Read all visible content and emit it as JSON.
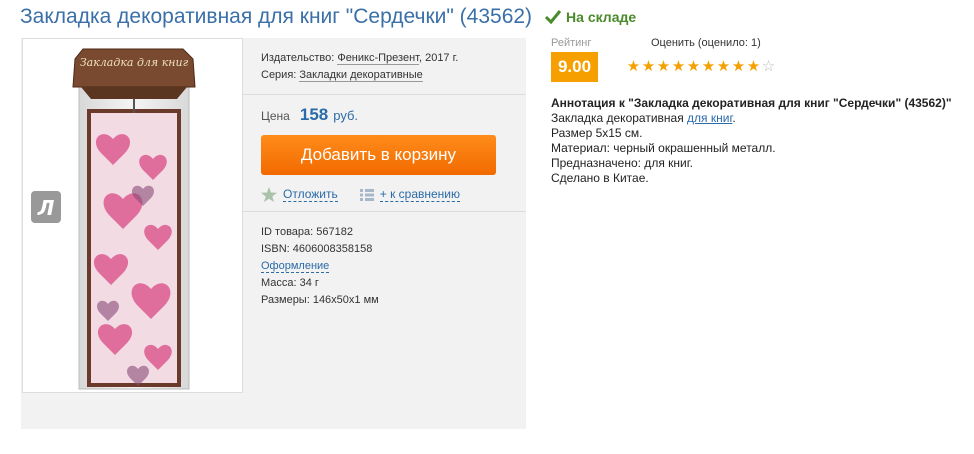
{
  "header": {
    "title": "Закладка декоративная для книг \"Сердечки\" (43562)",
    "stock": "На складе"
  },
  "details": {
    "publisher_label": "Издательство:",
    "publisher_link": "Феникс-Презент",
    "publisher_year": ", 2017 г.",
    "series_label": "Серия:",
    "series_link": "Закладки декоративные"
  },
  "price": {
    "label": "Цена",
    "value": "158",
    "currency": "руб."
  },
  "cart_button": "Добавить в корзину",
  "actions": {
    "defer": "Отложить",
    "compare": "+ к сравнению"
  },
  "meta": {
    "id_line": "ID товара: 567182",
    "isbn_line": "ISBN: 4606008358158",
    "design_link": "Оформление",
    "weight_line": "Масса: 34 г",
    "size_line": "Размеры: 146x50x1 мм"
  },
  "product_image": {
    "header_text": "Закладка для книг",
    "watermark": "Л"
  },
  "rating": {
    "label": "Рейтинг",
    "value": "9.00",
    "rate_label": "Оценить (оценило: 1)",
    "stars_filled": 9,
    "stars_total": 10
  },
  "annotation": {
    "title": "Аннотация к \"Закладка декоративная для книг \"Сердечки\" (43562)\"",
    "line1_prefix": "Закладка декоративная ",
    "line1_link": "для книг",
    "line1_suffix": ".",
    "line2": "Размер 5х15 см.",
    "line3": "Материал: черный окрашенный металл.",
    "line4": "Предназначено: для книг.",
    "line5": "Сделано в Китае."
  },
  "colors": {
    "link": "#2b6aa8",
    "accent": "#f5a000",
    "cart": "#f26a00",
    "stock": "#4a8a2a"
  }
}
